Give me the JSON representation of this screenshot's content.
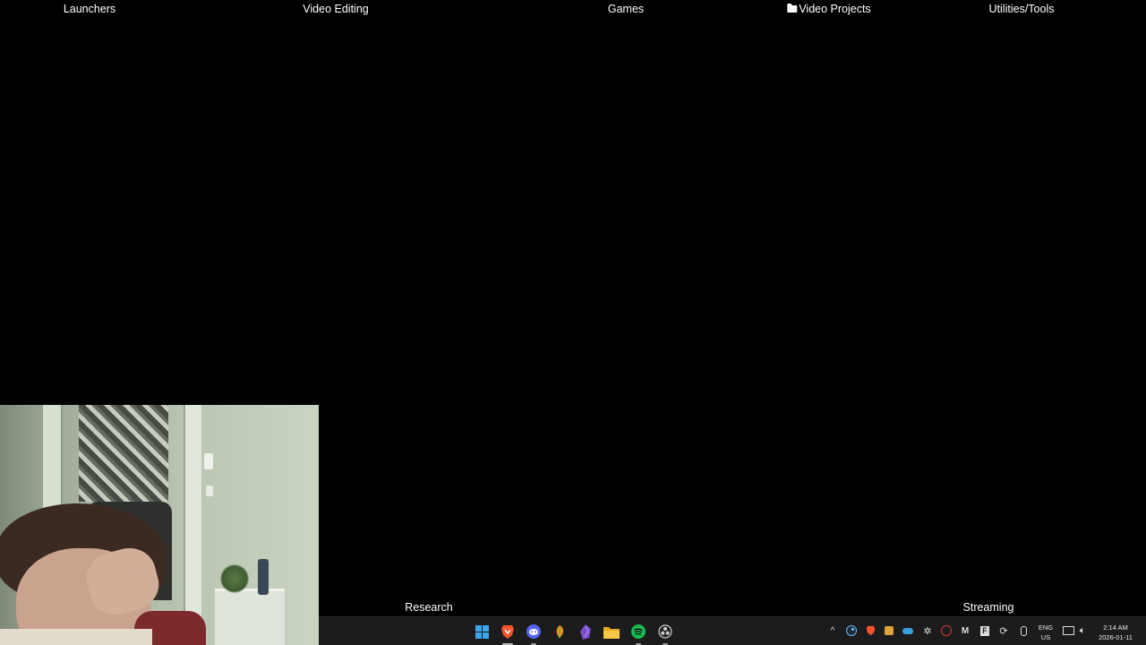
{
  "desktop": {
    "icons": [
      {
        "label": "Launchers"
      },
      {
        "label": "Video Editing"
      },
      {
        "label": "Games"
      },
      {
        "label": "Video Projects"
      },
      {
        "label": "Utilities/Tools"
      },
      {
        "label": "Research"
      },
      {
        "label": "Streaming"
      }
    ]
  },
  "taskbar": {
    "apps": [
      {
        "name": "start-icon"
      },
      {
        "name": "brave-icon",
        "color": "#fb542b"
      },
      {
        "name": "discord-icon",
        "color": "#5865f2"
      },
      {
        "name": "fl-studio-icon",
        "color": "#f08a24"
      },
      {
        "name": "obsidian-icon",
        "color": "#7c4dcc"
      },
      {
        "name": "file-explorer-icon",
        "color": "#f3c33f"
      },
      {
        "name": "spotify-icon",
        "color": "#1db954"
      },
      {
        "name": "obs-icon"
      }
    ],
    "tray": {
      "language": "ENG",
      "region": "US",
      "time": "2:14 AM",
      "date": "2026-01-11"
    }
  }
}
